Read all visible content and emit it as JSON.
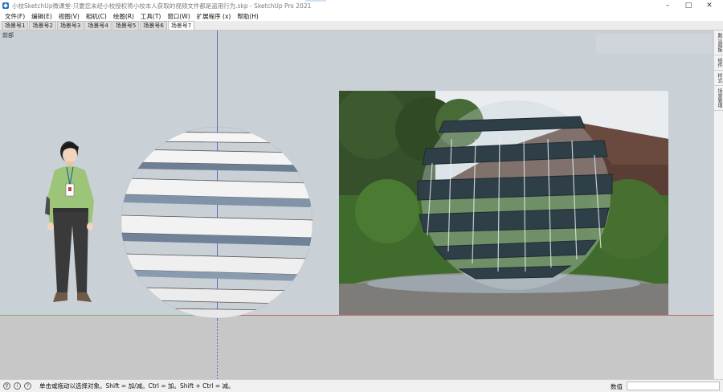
{
  "window": {
    "title": "小校SketchUp微课堂-只要您未经小校授权将小校本人获取的视频文件都是盗用行为.skp - SketchUp Pro 2021",
    "minimize": "–",
    "maximize": "□",
    "close": "✕"
  },
  "menu": {
    "items": [
      "文件(F)",
      "编辑(E)",
      "视图(V)",
      "相机(C)",
      "绘图(R)",
      "工具(T)",
      "窗口(W)",
      "扩展程序 (x)",
      "帮助(H)"
    ]
  },
  "scene_tabs": {
    "items": [
      "场景号1",
      "场景号2",
      "场景号3",
      "场景号4",
      "场景号5",
      "场景号6",
      "场景号7"
    ],
    "active_index": 6
  },
  "viewport": {
    "view_label": "前部",
    "colors": {
      "sky": "#c9d0d6",
      "ground": "#c7c7c7",
      "red_axis": "#c86464",
      "blue_axis": "#5b66c8",
      "green_axis": "#7fae7f"
    }
  },
  "right_panel": {
    "tabs": [
      "默认面板",
      "组件",
      "样式",
      "场景管理"
    ]
  },
  "status": {
    "icons": [
      "geolocation-icon",
      "credit-info-icon",
      "help-icon"
    ],
    "message": "单击或拖动以选择对象。Shift = 加/减。Ctrl = 加。Shift + Ctrl = 减。",
    "measure_label": "数值",
    "measure_value": ""
  }
}
